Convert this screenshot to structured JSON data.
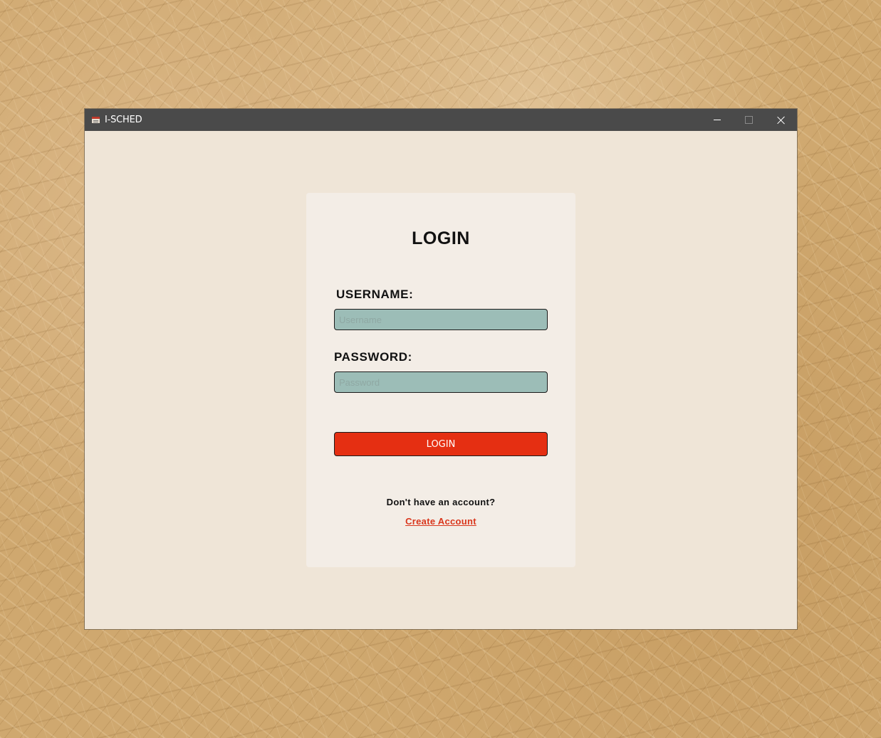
{
  "window": {
    "title": "I-SCHED",
    "app_icon": "calendar-icon",
    "controls": {
      "minimize_icon": "minimize-icon",
      "maximize_icon": "maximize-icon",
      "close_icon": "close-icon"
    }
  },
  "login_form": {
    "heading": "LOGIN",
    "username_label": "USERNAME:",
    "username_value": "",
    "username_placeholder": "Username",
    "password_label": "PASSWORD:",
    "password_value": "",
    "password_placeholder": "Password",
    "submit_label": "LOGIN",
    "signup_prompt": "Don't have an account?",
    "signup_link": "Create Account"
  },
  "colors": {
    "titlebar": "#4a4a4a",
    "window_bg": "#efe5d7",
    "card_bg": "#f3ede6",
    "input_bg": "#9cbdb7",
    "accent": "#e52f12",
    "link": "#d9361c"
  }
}
